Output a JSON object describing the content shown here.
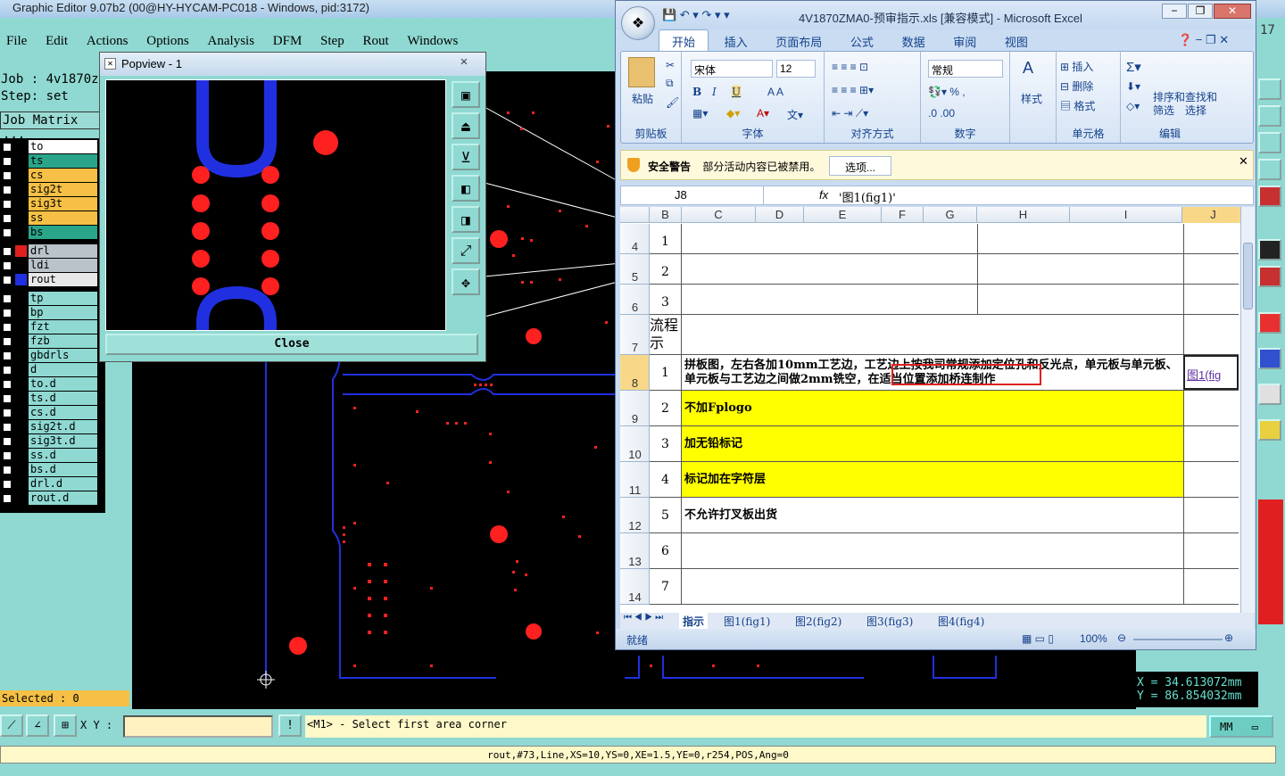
{
  "genesis": {
    "title": "Graphic Editor 9.07b2 (00@HY-HYCAM-PC018 - Windows, pid:3172)",
    "menu": [
      "File",
      "Edit",
      "Actions",
      "Options",
      "Analysis",
      "DFM",
      "Step",
      "Rout",
      "Windows"
    ],
    "job_label": "Job : 4v1870z",
    "step_label": "Step: set",
    "matrix_label": "Job Matrix ...",
    "layers": [
      {
        "name": "to",
        "color": "#ffffff",
        "sw": ""
      },
      {
        "name": "ts",
        "color": "#2aa58a",
        "sw": ""
      },
      {
        "name": "cs",
        "color": "#f5c045",
        "sw": ""
      },
      {
        "name": "sig2t",
        "color": "#f5c045",
        "sw": ""
      },
      {
        "name": "sig3t",
        "color": "#f5c045",
        "sw": ""
      },
      {
        "name": "ss",
        "color": "#f5c045",
        "sw": ""
      },
      {
        "name": "bs",
        "color": "#2aa58a",
        "sw": ""
      },
      {
        "name": "drl",
        "color": "#b9c3c9",
        "sw": "#e02020"
      },
      {
        "name": "ldi",
        "color": "#b9c3c9",
        "sw": ""
      },
      {
        "name": "rout",
        "color": "#e8e8e8",
        "sw": "#2030e0"
      },
      {
        "name": "tp",
        "color": "#8fd9d2",
        "sw": ""
      },
      {
        "name": "bp",
        "color": "#8fd9d2",
        "sw": ""
      },
      {
        "name": "fzt",
        "color": "#8fd9d2",
        "sw": ""
      },
      {
        "name": "fzb",
        "color": "#8fd9d2",
        "sw": ""
      },
      {
        "name": "gbdrls",
        "color": "#8fd9d2",
        "sw": ""
      },
      {
        "name": "d",
        "color": "#8fd9d2",
        "sw": ""
      },
      {
        "name": "to.d",
        "color": "#8fd9d2",
        "sw": ""
      },
      {
        "name": "ts.d",
        "color": "#8fd9d2",
        "sw": ""
      },
      {
        "name": "cs.d",
        "color": "#8fd9d2",
        "sw": ""
      },
      {
        "name": "sig2t.d",
        "color": "#8fd9d2",
        "sw": ""
      },
      {
        "name": "sig3t.d",
        "color": "#8fd9d2",
        "sw": ""
      },
      {
        "name": "ss.d",
        "color": "#8fd9d2",
        "sw": ""
      },
      {
        "name": "bs.d",
        "color": "#8fd9d2",
        "sw": ""
      },
      {
        "name": "drl.d",
        "color": "#8fd9d2",
        "sw": ""
      },
      {
        "name": "rout.d",
        "color": "#8fd9d2",
        "sw": ""
      }
    ],
    "selected": "Selected : 0",
    "xy_label": "X Y :",
    "xy_value": "",
    "prompt": "<M1> - Select first area corner",
    "units": "MM",
    "status": "rout,#73,Line,XS=10,YS=0,XE=1.5,YE=0,r254,POS,Ang=0",
    "coord_x": "X = 34.613072mm",
    "coord_y": "Y = 86.854032mm",
    "side_text": "17"
  },
  "popview": {
    "title": "Popview - 1",
    "close_label": "Close"
  },
  "excel": {
    "title": "4V1870ZMA0-预审指示.xls  [兼容模式] - Microsoft Excel",
    "tabs": [
      "开始",
      "插入",
      "页面布局",
      "公式",
      "数据",
      "审阅",
      "视图"
    ],
    "clipboard": {
      "paste": "粘贴",
      "label": "剪贴板"
    },
    "font": {
      "name": "宋体",
      "size": "12",
      "label": "字体"
    },
    "align_label": "对齐方式",
    "number": {
      "format": "常规",
      "label": "数字"
    },
    "styles_label": "样式",
    "cells": {
      "insert": "插入",
      "delete": "删除",
      "format": "格式",
      "label": "单元格"
    },
    "editing": {
      "sort": "排序和\n筛选",
      "find": "查找和\n选择",
      "label": "编辑"
    },
    "security_title": "安全警告",
    "security_msg": "部分活动内容已被禁用。",
    "security_btn": "选项...",
    "namebox": "J8",
    "formula": "'图1(fig1)'",
    "columns": [
      "B",
      "C",
      "D",
      "E",
      "F",
      "G",
      "H",
      "I",
      "J"
    ],
    "rows": [
      {
        "rh": "4",
        "num": "1",
        "text": "",
        "fill": "#ffffff"
      },
      {
        "rh": "5",
        "num": "2",
        "text": "",
        "fill": "#ffffff"
      },
      {
        "rh": "6",
        "num": "3",
        "text": "",
        "fill": "#ffffff"
      },
      {
        "rh": "7",
        "num": "流程\n示",
        "text": "",
        "fill": "#ffffff"
      },
      {
        "rh": "8",
        "num": "1",
        "text": "拼板图，左右各加10mm工艺边，工艺边上按我司常规添加定位孔和反光点，单元板与单元板、单元板与工艺边之间做2mm铣空，在适当位置添加桥连制作",
        "fill": "#ffffff"
      },
      {
        "rh": "9",
        "num": "2",
        "text": "不加Fplogo",
        "fill": "#ffff00"
      },
      {
        "rh": "10",
        "num": "3",
        "text": "加无铅标记",
        "fill": "#ffff00"
      },
      {
        "rh": "11",
        "num": "4",
        "text": "标记加在字符层",
        "fill": "#ffff00"
      },
      {
        "rh": "12",
        "num": "5",
        "text": "不允许打叉板出货",
        "fill": "#ffffff"
      },
      {
        "rh": "13",
        "num": "6",
        "text": "",
        "fill": "#ffffff"
      },
      {
        "rh": "14",
        "num": "7",
        "text": "",
        "fill": "#ffffff"
      }
    ],
    "j8_text": "图1(fig",
    "sheet_tabs": [
      "指示",
      "图1(fig1)",
      "图2(fig2)",
      "图3(fig3)",
      "图4(fig4)"
    ],
    "status_ready": "就绪",
    "zoom": "100%"
  }
}
